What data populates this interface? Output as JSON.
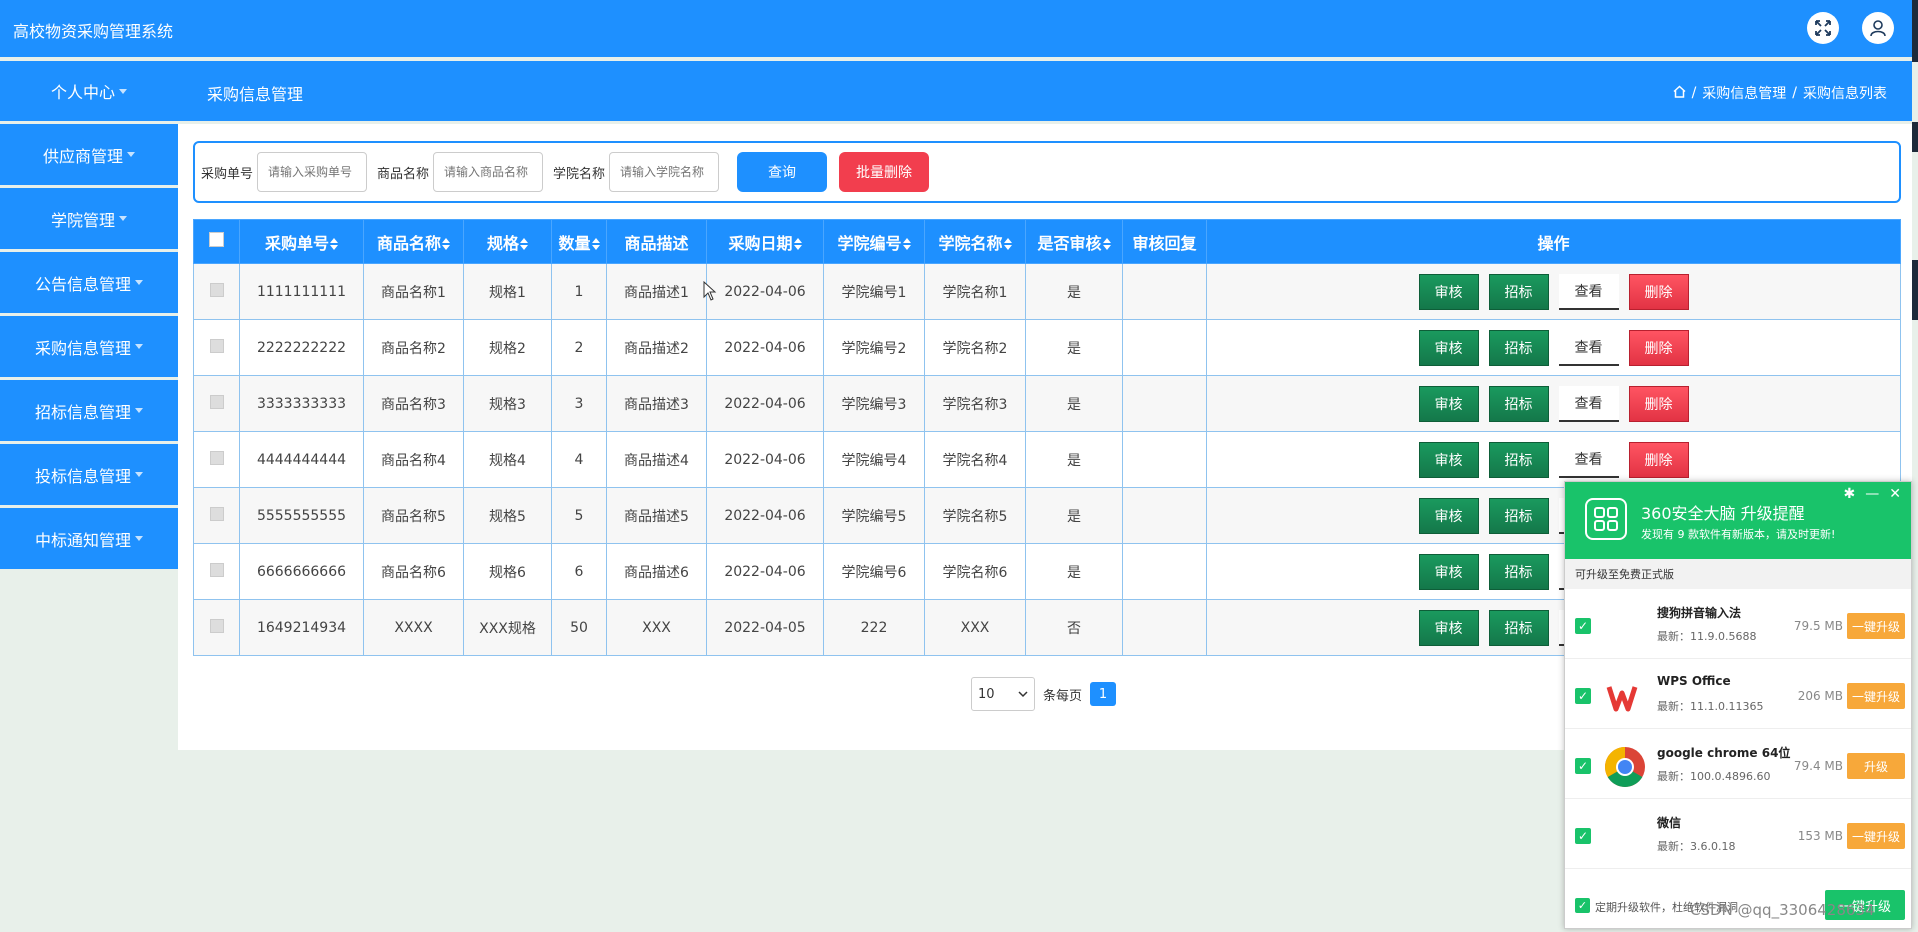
{
  "app": {
    "title": "高校物资采购管理系统"
  },
  "header": {
    "personal_center": "个人中心",
    "page_title": "采购信息管理",
    "breadcrumb": [
      "采购信息管理",
      "采购信息列表"
    ]
  },
  "sidebar": {
    "items": [
      {
        "label": "供应商管理"
      },
      {
        "label": "学院管理"
      },
      {
        "label": "公告信息管理"
      },
      {
        "label": "采购信息管理"
      },
      {
        "label": "招标信息管理"
      },
      {
        "label": "投标信息管理"
      },
      {
        "label": "中标通知管理"
      }
    ]
  },
  "search": {
    "order_label": "采购单号",
    "order_placeholder": "请输入采购单号",
    "product_label": "商品名称",
    "product_placeholder": "请输入商品名称",
    "college_label": "学院名称",
    "college_placeholder": "请输入学院名称",
    "query_button": "查询",
    "batch_delete_button": "批量删除"
  },
  "table": {
    "columns": [
      "采购单号",
      "商品名称",
      "规格",
      "数量",
      "商品描述",
      "采购日期",
      "学院编号",
      "学院名称",
      "是否审核",
      "审核回复",
      "操作"
    ],
    "rows": [
      [
        "1111111111",
        "商品名称1",
        "规格1",
        "1",
        "商品描述1",
        "2022-04-06",
        "学院编号1",
        "学院名称1",
        "是",
        ""
      ],
      [
        "2222222222",
        "商品名称2",
        "规格2",
        "2",
        "商品描述2",
        "2022-04-06",
        "学院编号2",
        "学院名称2",
        "是",
        ""
      ],
      [
        "3333333333",
        "商品名称3",
        "规格3",
        "3",
        "商品描述3",
        "2022-04-06",
        "学院编号3",
        "学院名称3",
        "是",
        ""
      ],
      [
        "4444444444",
        "商品名称4",
        "规格4",
        "4",
        "商品描述4",
        "2022-04-06",
        "学院编号4",
        "学院名称4",
        "是",
        ""
      ],
      [
        "5555555555",
        "商品名称5",
        "规格5",
        "5",
        "商品描述5",
        "2022-04-06",
        "学院编号5",
        "学院名称5",
        "是",
        ""
      ],
      [
        "6666666666",
        "商品名称6",
        "规格6",
        "6",
        "商品描述6",
        "2022-04-06",
        "学院编号6",
        "学院名称6",
        "是",
        ""
      ],
      [
        "1649214934",
        "XXXX",
        "XXX规格",
        "50",
        "XXX",
        "2022-04-05",
        "222",
        "XXX",
        "否",
        ""
      ]
    ],
    "actions": {
      "review": "审核",
      "tender": "招标",
      "view": "查看",
      "delete": "删除"
    }
  },
  "pager": {
    "page_size": "10",
    "per_page_label": "条每页",
    "current_page": "1"
  },
  "popup": {
    "title": "360安全大脑 升级提醒",
    "subtitle": "发现有 9 款软件有新版本，请及时更新!",
    "section": "可升级至免费正式版",
    "apps": [
      {
        "name": "搜狗拼音输入法",
        "version": "最新：11.9.0.5688",
        "size": "79.5 MB",
        "button": "一键升级",
        "icon": "sogou-icon"
      },
      {
        "name": "WPS Office",
        "version": "最新：11.1.0.11365",
        "size": "206 MB",
        "button": "一键升级",
        "icon": "wps-icon"
      },
      {
        "name": "google chrome 64位",
        "version": "最新：100.0.4896.60",
        "size": "79.4 MB",
        "button": "升级",
        "icon": "chrome-icon"
      },
      {
        "name": "微信",
        "version": "最新：3.6.0.18",
        "size": "153 MB",
        "button": "一键升级",
        "icon": "wechat-icon"
      }
    ],
    "footer_text": "定期升级软件，杜绝软件漏洞",
    "footer_button": "一键升级"
  },
  "watermark": "CSDN @qq_3306428634",
  "colors": {
    "primary": "#1e90ff",
    "danger": "#f23e4e",
    "success": "#19c36a",
    "review": "#14784a",
    "upgrade": "#f7a83a"
  }
}
